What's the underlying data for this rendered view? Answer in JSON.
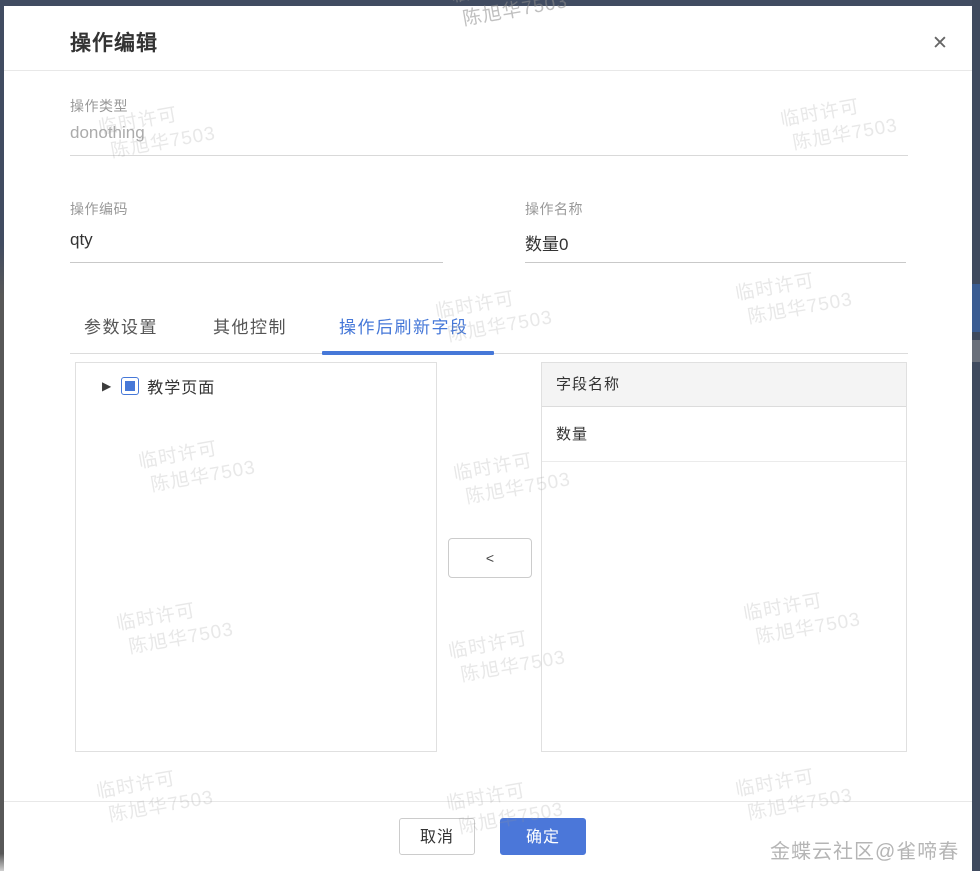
{
  "dialog": {
    "title": "操作编辑",
    "close_icon": "✕"
  },
  "fields": {
    "op_type": {
      "label": "操作类型",
      "value": "donothing",
      "disabled": true
    },
    "op_code": {
      "label": "操作编码",
      "value": "qty"
    },
    "op_name": {
      "label": "操作名称",
      "value": "数量0"
    }
  },
  "tabs": [
    {
      "label": "参数设置",
      "active": false
    },
    {
      "label": "其他控制",
      "active": false
    },
    {
      "label": "操作后刷新字段",
      "active": true
    }
  ],
  "tree": {
    "expander_icon": "▶",
    "node_label": "教学页面",
    "checkbox_state": "indeterminate"
  },
  "transfer": {
    "move_left_label": "<"
  },
  "table": {
    "header": "字段名称",
    "rows": [
      "数量"
    ]
  },
  "footer": {
    "cancel_label": "取消",
    "confirm_label": "确定"
  },
  "watermark": {
    "line1": "临时许可",
    "line2": "陈旭华7503"
  },
  "credit": "金蝶云社区@雀啼春",
  "colors": {
    "accent_blue": "#4678d8",
    "confirm_blue": "#4b77d9",
    "frame_dark": "#414c61"
  }
}
